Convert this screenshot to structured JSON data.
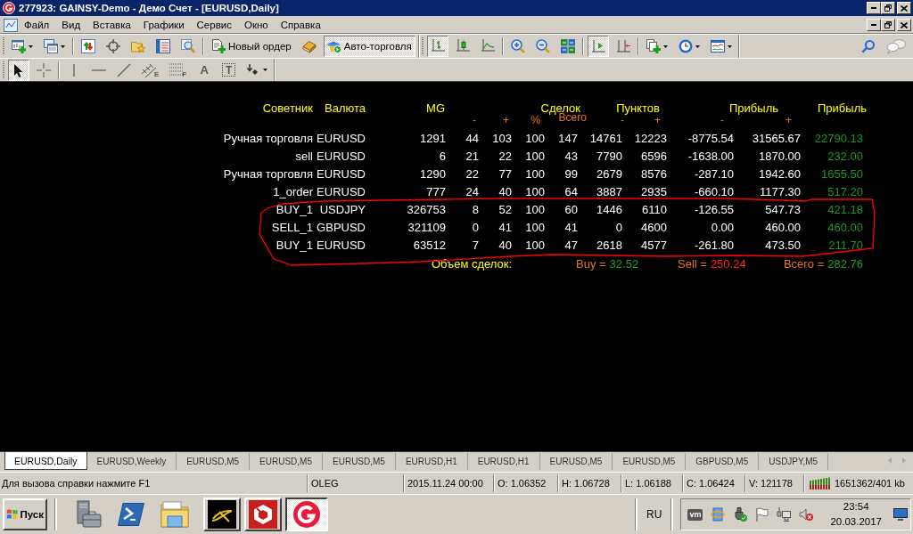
{
  "window": {
    "title": "277923: GAINSY-Demo - Демо Счет - [EURUSD,Daily]"
  },
  "menu": [
    "Файл",
    "Вид",
    "Вставка",
    "Графики",
    "Сервис",
    "Окно",
    "Справка"
  ],
  "toolbar_rows": [
    {
      "toolbars": [
        {
          "groups": [
            [
              {
                "kind": "chart",
                "dropdown": true,
                "pressed": false
              },
              {
                "kind": "profiles",
                "dropdown": true,
                "pressed": false
              }
            ],
            [
              {
                "kind": "market",
                "dropdown": false,
                "pressed": false
              },
              {
                "kind": "navigator",
                "dropdown": false,
                "pressed": false
              },
              {
                "kind": "favorites",
                "dropdown": false,
                "pressed": false
              },
              {
                "kind": "data",
                "dropdown": false,
                "pressed": false
              },
              {
                "kind": "tester",
                "dropdown": false,
                "pressed": false
              }
            ],
            [
              {
                "kind": "order",
                "label": "Новый ордер",
                "dropdown": false,
                "pressed": false
              },
              {
                "kind": "editor",
                "dropdown": false,
                "pressed": false
              },
              {
                "kind": "auto",
                "label": "Авто-торговля",
                "dropdown": false,
                "pressed": true
              }
            ]
          ]
        },
        {
          "groups": [
            [
              {
                "kind": "bars",
                "dropdown": false,
                "pressed": true
              },
              {
                "kind": "candles",
                "dropdown": false,
                "pressed": false
              },
              {
                "kind": "line",
                "dropdown": false,
                "pressed": false
              }
            ],
            [
              {
                "kind": "zoomin",
                "dropdown": false,
                "pressed": false
              },
              {
                "kind": "zoomout",
                "dropdown": false,
                "pressed": false
              },
              {
                "kind": "tile",
                "dropdown": false,
                "pressed": false
              }
            ],
            [
              {
                "kind": "scroll",
                "dropdown": false,
                "pressed": true
              },
              {
                "kind": "shift",
                "dropdown": false,
                "pressed": false
              }
            ],
            [
              {
                "kind": "indicators",
                "dropdown": true,
                "pressed": false
              },
              {
                "kind": "periods",
                "dropdown": true,
                "pressed": false
              },
              {
                "kind": "templates",
                "dropdown": true,
                "pressed": false
              }
            ]
          ]
        }
      ],
      "tools": [
        {
          "kind": "search",
          "dropdown": false,
          "pressed": false
        },
        {
          "kind": "chat",
          "dropdown": false,
          "pressed": false
        }
      ]
    },
    {
      "toolbars": [
        {
          "groups": [
            [
              {
                "kind": "cursor",
                "dropdown": false,
                "pressed": true
              },
              {
                "kind": "crosshair",
                "dropdown": false,
                "pressed": false
              }
            ],
            [
              {
                "kind": "vline",
                "dropdown": false,
                "pressed": false
              },
              {
                "kind": "hline",
                "dropdown": false,
                "pressed": false
              },
              {
                "kind": "trend",
                "dropdown": false,
                "pressed": false
              },
              {
                "kind": "channel",
                "glyph": "E",
                "dropdown": false,
                "pressed": false
              },
              {
                "kind": "fibo",
                "glyph": "F",
                "dropdown": false,
                "pressed": false
              },
              {
                "kind": "text",
                "glyph": "A",
                "dropdown": false,
                "pressed": false
              },
              {
                "kind": "label",
                "glyph": "T",
                "dropdown": false,
                "pressed": false
              },
              {
                "kind": "arrows",
                "dropdown": true,
                "pressed": false
              }
            ]
          ]
        }
      ]
    }
  ],
  "table": {
    "headers": [
      "Советник",
      "Валюта",
      "MG",
      "Сделок",
      "Пунктов",
      "Прибыль",
      "Прибыль"
    ],
    "subheaders": [
      "-",
      "+",
      "%",
      "Всего",
      "-",
      "+",
      "-",
      "+"
    ],
    "rows": [
      [
        "Ручная торговля",
        "EURUSD",
        "1291",
        "44",
        "103",
        "100",
        "147",
        "14761",
        "12223",
        "-8775.54",
        "31565.67",
        "22790.13"
      ],
      [
        "sell",
        "EURUSD",
        "6",
        "21",
        "22",
        "100",
        "43",
        "7790",
        "6596",
        "-1638.00",
        "1870.00",
        "232.00"
      ],
      [
        "Ручная торговля",
        "EURUSD",
        "1290",
        "22",
        "77",
        "100",
        "99",
        "2679",
        "8576",
        "-287.10",
        "1942.60",
        "1655.50"
      ],
      [
        "1_order",
        "EURUSD",
        "777",
        "24",
        "40",
        "100",
        "64",
        "3887",
        "2935",
        "-660.10",
        "1177.30",
        "517.20"
      ],
      [
        "BUY_1",
        "USDJPY",
        "326753",
        "8",
        "52",
        "100",
        "60",
        "1446",
        "6110",
        "-126.55",
        "547.73",
        "421.18"
      ],
      [
        "SELL_1",
        "GBPUSD",
        "321109",
        "0",
        "41",
        "100",
        "41",
        "0",
        "4600",
        "0.00",
        "460.00",
        "460.00"
      ],
      [
        "BUY_1",
        "EURUSD",
        "63512",
        "7",
        "40",
        "100",
        "47",
        "2618",
        "4577",
        "-261.80",
        "473.50",
        "211.70"
      ]
    ],
    "summary": {
      "label": "Объем сделок:",
      "items": [
        {
          "label": "Buy =",
          "value": "32.52",
          "color": "#22a022"
        },
        {
          "label": "Sell =",
          "value": "250.24",
          "color": "#ff2020"
        },
        {
          "label": "Всего =",
          "value": "282.76",
          "color": "#22a022"
        }
      ]
    }
  },
  "tabs": [
    {
      "label": "EURUSD,Daily",
      "selected": true
    },
    {
      "label": "EURUSD,Weekly",
      "selected": false
    },
    {
      "label": "EURUSD,M5",
      "selected": false
    },
    {
      "label": "EURUSD,M5",
      "selected": false
    },
    {
      "label": "EURUSD,M5",
      "selected": false
    },
    {
      "label": "EURUSD,H1",
      "selected": false
    },
    {
      "label": "EURUSD,H1",
      "selected": false
    },
    {
      "label": "EURUSD,M5",
      "selected": false
    },
    {
      "label": "EURUSD,M5",
      "selected": false
    },
    {
      "label": "GBPUSD,M5",
      "selected": false
    },
    {
      "label": "USDJPY,M5",
      "selected": false
    }
  ],
  "status_bar": {
    "sections": [
      "Для вызова справки нажмите F1",
      "OLEG",
      "2015.11.24 00:00",
      "O: 1.06352",
      "H: 1.06728",
      "L: 1.06188",
      "C: 1.06424",
      "V: 121178"
    ],
    "traffic": "1651362/401 kb"
  },
  "taskbar": {
    "start": "Пуск",
    "tasks": [
      {
        "kind": "swoosh",
        "selected": false
      },
      {
        "kind": "hexagon",
        "selected": false
      },
      {
        "kind": "ring",
        "selected": true
      }
    ],
    "language": "RU",
    "tray_badge": "vm",
    "clock": {
      "time": "23:54",
      "date": "20.03.2017"
    }
  }
}
